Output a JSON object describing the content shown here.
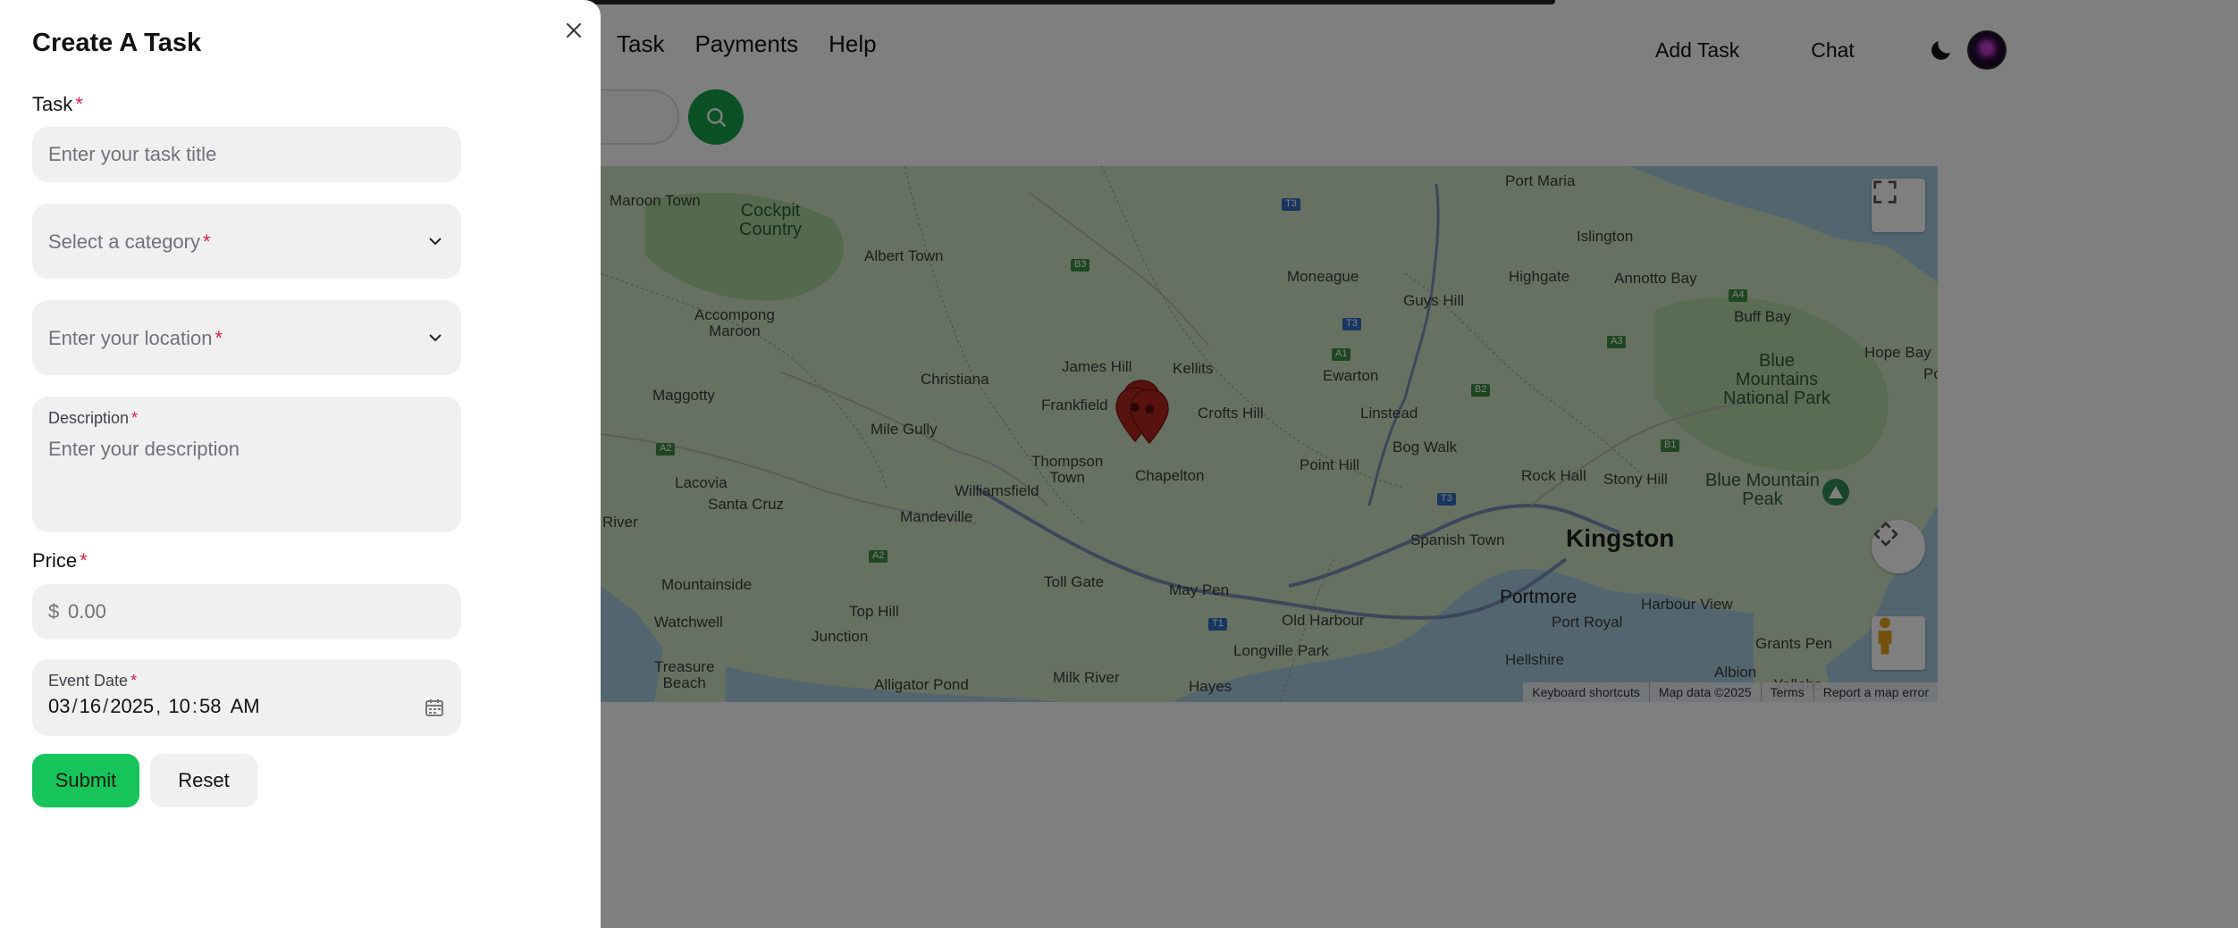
{
  "nav": {
    "items": [
      "Task",
      "Payments",
      "Help"
    ],
    "add_task": "Add Task",
    "chat": "Chat"
  },
  "map": {
    "labels": {
      "kingston": "Kingston",
      "portmore": "Portmore",
      "cockpit_country": "Cockpit\nCountry",
      "blue_mountains_np": "Blue\nMountains\nNational Park",
      "blue_mountain_peak": "Blue Mountain\nPeak",
      "maroon_town": "Maroon Town",
      "albert_town": "Albert Town",
      "accompong_maroon": "Accompong\nMaroon",
      "maggotty": "Maggotty",
      "christiana": "Christiana",
      "james_hill": "James Hill",
      "kellits": "Kellits",
      "frankfield": "Frankfield",
      "crofts_hill": "Crofts Hill",
      "mile_gully": "Mile Gully",
      "thompson_town": "Thompson\nTown",
      "chapelton": "Chapelton",
      "lacovia": "Lacovia",
      "santa_cruz": "Santa Cruz",
      "mandeville": "Mandeville",
      "williamsfield": "Williamsfield",
      "river": "River",
      "mountainside": "Mountainside",
      "watchwell": "Watchwell",
      "top_hill": "Top Hill",
      "junction": "Junction",
      "treasure_beach": "Treasure\nBeach",
      "alligator_pond": "Alligator Pond",
      "toll_gate": "Toll Gate",
      "may_pen": "May Pen",
      "milk_river": "Milk River",
      "hayes": "Hayes",
      "old_harbour": "Old Harbour",
      "longville_park": "Longville Park",
      "moneague": "Moneague",
      "guys_hill": "Guys Hill",
      "ewarton": "Ewarton",
      "linstead": "Linstead",
      "point_hill": "Point Hill",
      "bog_walk": "Bog Walk",
      "spanish_town": "Spanish Town",
      "rock_hall": "Rock Hall",
      "stony_hill": "Stony Hill",
      "port_maria": "Port Maria",
      "islington": "Islington",
      "highgate": "Highgate",
      "annotto_bay": "Annotto Bay",
      "buff_bay": "Buff Bay",
      "hope_bay": "Hope Bay",
      "port_royal": "Port Royal",
      "harbour_view": "Harbour View",
      "hellshire": "Hellshire",
      "grants_pen": "Grants Pen",
      "albion": "Albion",
      "yallahs": "Yallahs",
      "po": "Po"
    },
    "roads": [
      "T3",
      "B3",
      "T3",
      "A1",
      "A3",
      "A4",
      "B2",
      "B1",
      "T3",
      "A2",
      "A2",
      "T1"
    ],
    "footer": [
      "Keyboard shortcuts",
      "Map data ©2025",
      "Terms",
      "Report a map error"
    ]
  },
  "drawer": {
    "title": "Create A Task",
    "task_label": "Task",
    "task_placeholder": "Enter your task title",
    "category_placeholder": "Select a category",
    "location_placeholder": "Enter your location",
    "description_label": "Description",
    "description_placeholder": "Enter your description",
    "price_label": "Price",
    "price_currency": "$",
    "price_placeholder": "0.00",
    "event_date_label": "Event Date",
    "date": {
      "month": "03",
      "day": "16",
      "year": "2025",
      "hour": "10",
      "minute": "58",
      "ampm": "AM"
    },
    "required_mark": "*",
    "submit_label": "Submit",
    "reset_label": "Reset"
  },
  "colors": {
    "accent_green": "#16c45b",
    "required_red": "#e11d48",
    "pin_red": "#b3261e"
  }
}
